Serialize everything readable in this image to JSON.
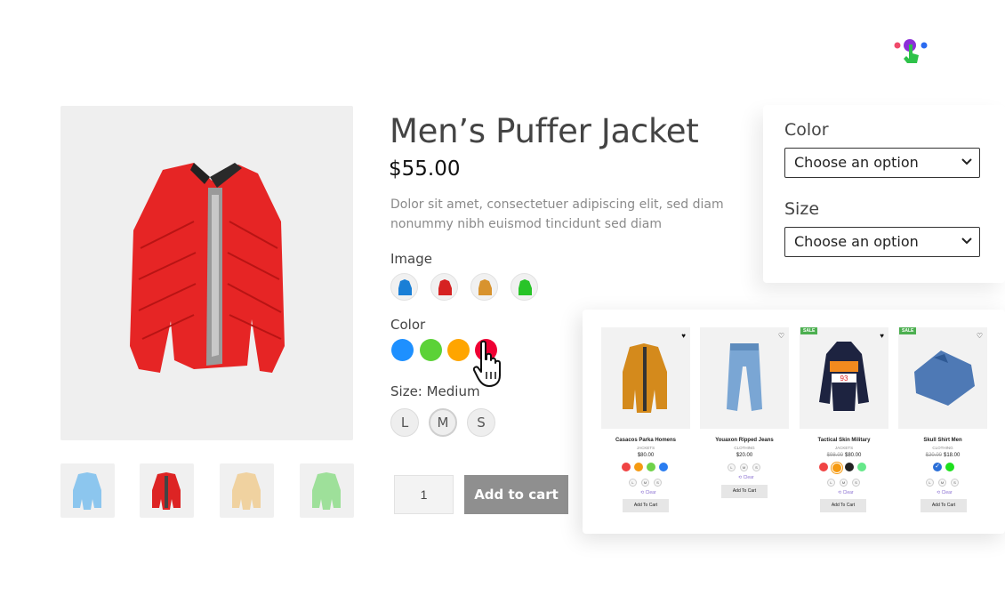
{
  "product": {
    "title": "Men’s Puffer Jacket",
    "price": "$55.00",
    "description": "Dolor sit amet, consectetuer adipiscing elit, sed diam nonummy nibh euismod tincidunt sed diam",
    "image_label": "Image",
    "color_label": "Color",
    "size_label": "Size: Medium",
    "sizes": [
      "L",
      "M",
      "S"
    ],
    "selected_size": "M",
    "colors": [
      "#1e90ff",
      "#5bd237",
      "#ffa500",
      "#ee0033"
    ],
    "quantity": "1",
    "add_to_cart": "Add to cart"
  },
  "variation_panel": {
    "color_label": "Color",
    "color_select": "Choose an option",
    "size_label": "Size",
    "size_select": "Choose an option"
  },
  "grid": {
    "cards": [
      {
        "name": "Casacos Parka Homens",
        "category": "JACKETS",
        "price": "$80.00",
        "old_price": "",
        "sale": false,
        "heart_filled": true,
        "button": "Add To Cart",
        "clear": "Clear",
        "has_clear": true
      },
      {
        "name": "Youaxon Ripped Jeans",
        "category": "CLOTHING",
        "price": "$20.00",
        "old_price": "",
        "sale": false,
        "heart_filled": false,
        "button": "Add To Cart",
        "clear": "Clear",
        "has_clear": true
      },
      {
        "name": "Tactical Skin Military",
        "category": "JACKETS",
        "price": "$80.00",
        "old_price": "$98.00",
        "sale": true,
        "sale_label": "SALE",
        "heart_filled": true,
        "button": "Add To Cart",
        "clear": "Clear",
        "has_clear": true
      },
      {
        "name": "Skull Shirt Men",
        "category": "CLOTHING",
        "price": "$18.00",
        "old_price": "$20.00",
        "sale": true,
        "sale_label": "SALE",
        "heart_filled": false,
        "button": "Add To Cart",
        "clear": "Clear",
        "has_clear": true
      }
    ],
    "mini_sizes": [
      "L",
      "M",
      "S"
    ]
  }
}
